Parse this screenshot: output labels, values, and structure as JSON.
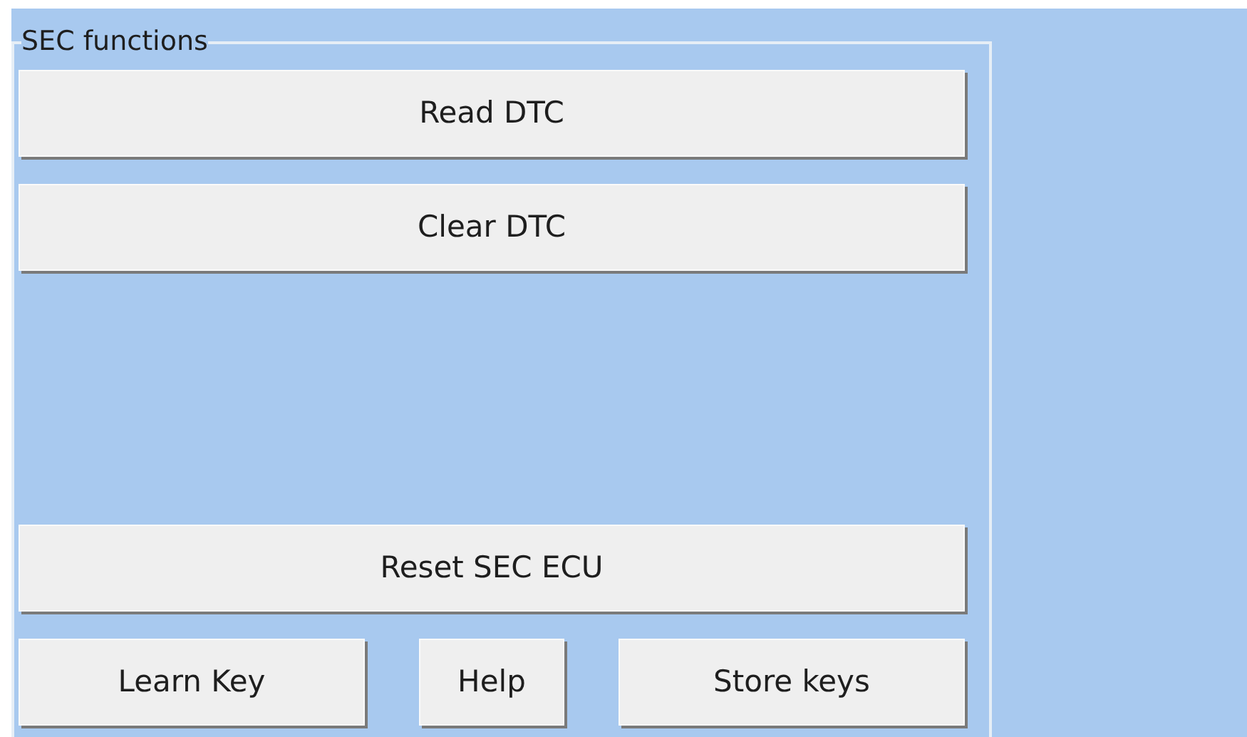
{
  "group": {
    "title": "SEC functions"
  },
  "top_buttons": [
    "Read DTC",
    "Clear DTC"
  ],
  "middle_buttons": [
    "Reset SEC ECU"
  ],
  "bottom_buttons": [
    "Learn Key",
    "Help",
    "Store keys"
  ]
}
